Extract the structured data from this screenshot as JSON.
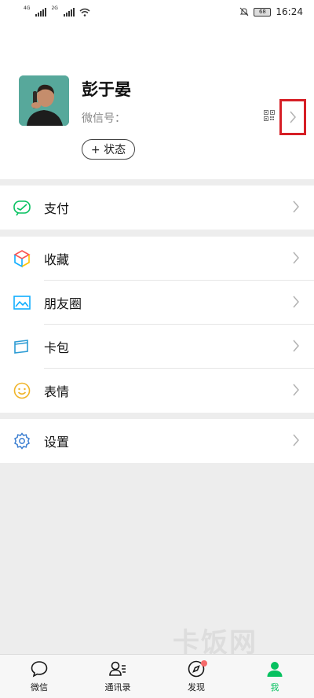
{
  "statusbar": {
    "sim1": "4G",
    "sim2": "2G",
    "battery": "68",
    "time": "16:24",
    "icons": [
      "signal-icon",
      "wifi-icon",
      "mute-bell-icon",
      "battery-icon"
    ]
  },
  "profile": {
    "name": "彭于晏",
    "wechat_id_label": "微信号：",
    "status_button": "+ 状态",
    "icons": [
      "qr-code-icon",
      "chevron-right-icon"
    ]
  },
  "menu": {
    "pay": "支付",
    "favorites": "收藏",
    "moments": "朋友圈",
    "cards": "卡包",
    "stickers": "表情",
    "settings": "设置"
  },
  "tabbar": {
    "tabs": [
      {
        "label": "微信",
        "icon": "chat-bubble-icon"
      },
      {
        "label": "通讯录",
        "icon": "contacts-icon"
      },
      {
        "label": "发现",
        "icon": "compass-icon"
      },
      {
        "label": "我",
        "icon": "person-icon"
      }
    ],
    "active": "我"
  },
  "colors": {
    "accent": "#07c160",
    "highlight_box": "#d61f26",
    "favorites_icon": [
      "#fa5151",
      "#ffc300",
      "#10aeff",
      "#07c160"
    ],
    "moments_icon": "#10aeff",
    "cards_icon": "#2b9bd4",
    "stickers_icon": "#f0b429",
    "settings_icon": "#3d7fd1",
    "badge": "#f56a6a"
  },
  "watermark": "卡饭网"
}
